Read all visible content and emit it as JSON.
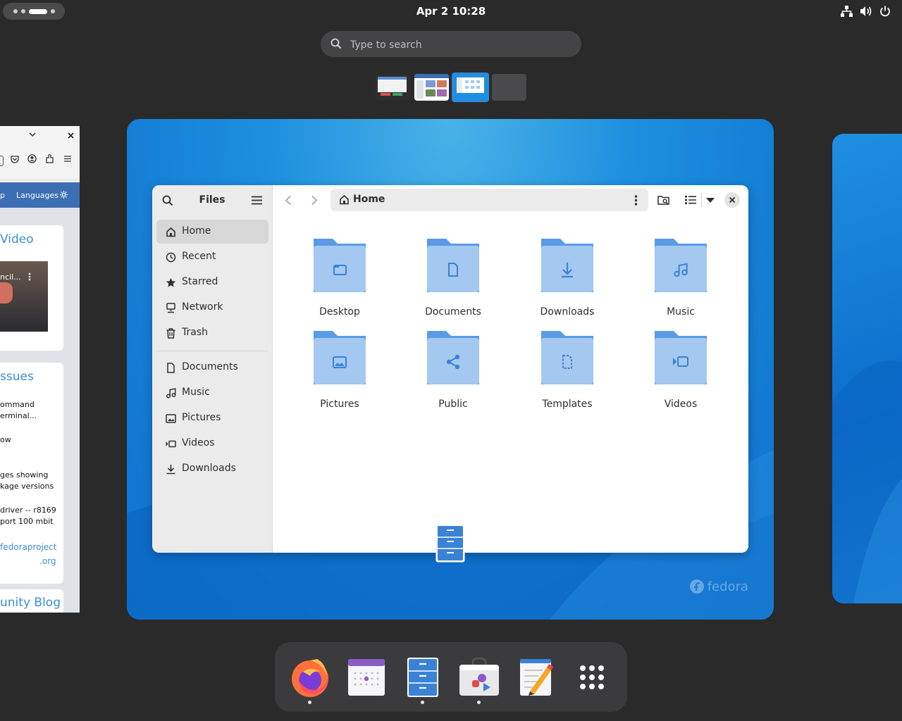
{
  "topbar": {
    "clock": "Apr 2  10:28",
    "tray_icons": [
      "network-icon",
      "volume-icon",
      "power-icon"
    ]
  },
  "search": {
    "placeholder": "Type to search"
  },
  "left_window": {
    "nav_label": "Languages",
    "nav_left_fragment": "p",
    "card1_heading": "Video",
    "video_title_fragment": "ncil...",
    "card2_heading": "ssues",
    "lines": [
      "ommand",
      "erminal...",
      "ow",
      "ges showing",
      "kage versions",
      "driver -- r8169",
      "port 100 mbit"
    ],
    "link_lines": [
      "fedoraproject",
      ".org"
    ],
    "card3_heading": "unity Blog"
  },
  "files": {
    "title": "Files",
    "location": "Home",
    "sidebar_places": [
      {
        "label": "Home",
        "icon": "home-icon",
        "active": true
      },
      {
        "label": "Recent",
        "icon": "clock-icon",
        "active": false
      },
      {
        "label": "Starred",
        "icon": "star-icon",
        "active": false
      },
      {
        "label": "Network",
        "icon": "network-icon",
        "active": false
      },
      {
        "label": "Trash",
        "icon": "trash-icon",
        "active": false
      }
    ],
    "sidebar_bookmarks": [
      {
        "label": "Documents",
        "icon": "document-icon"
      },
      {
        "label": "Music",
        "icon": "music-icon"
      },
      {
        "label": "Pictures",
        "icon": "picture-icon"
      },
      {
        "label": "Videos",
        "icon": "video-icon"
      },
      {
        "label": "Downloads",
        "icon": "download-icon"
      }
    ],
    "folders": [
      {
        "label": "Desktop",
        "icon": "folder-icon"
      },
      {
        "label": "Documents",
        "icon": "document-icon"
      },
      {
        "label": "Downloads",
        "icon": "download-icon"
      },
      {
        "label": "Music",
        "icon": "music-icon"
      },
      {
        "label": "Pictures",
        "icon": "picture-icon"
      },
      {
        "label": "Public",
        "icon": "share-icon"
      },
      {
        "label": "Templates",
        "icon": "template-icon"
      },
      {
        "label": "Videos",
        "icon": "video-icon"
      }
    ]
  },
  "wallpaper_brand": "fedora",
  "dash": {
    "apps": [
      {
        "name": "Firefox",
        "running": true
      },
      {
        "name": "Calendar",
        "running": false
      },
      {
        "name": "Files",
        "running": true
      },
      {
        "name": "Software",
        "running": true
      },
      {
        "name": "Text Editor",
        "running": false
      },
      {
        "name": "Show Apps",
        "running": false
      }
    ]
  },
  "colors": {
    "accent": "#3584e4",
    "folder": "#a4c8f0",
    "folder_tab": "#5a9ae6",
    "wallpaper": "#0c6fcc"
  }
}
